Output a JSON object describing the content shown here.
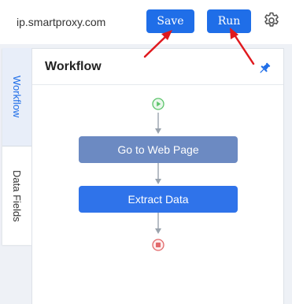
{
  "topbar": {
    "url": "ip.smartproxy.com",
    "save_label": "Save",
    "run_label": "Run",
    "settings_icon": "gear-icon"
  },
  "tabs": [
    {
      "label": "Workflow",
      "active": true
    },
    {
      "label": "Data Fields",
      "active": false
    }
  ],
  "panel": {
    "title": "Workflow",
    "pin_icon": "pin-icon"
  },
  "workflow": {
    "steps": [
      {
        "label": "Go to Web Page"
      },
      {
        "label": "Extract Data"
      }
    ]
  },
  "colors": {
    "primary": "#1f6ee8",
    "step_goto": "#6c8ac2",
    "step_extract": "#2f73ea",
    "start_node": "#5cc46a",
    "end_node": "#e2696b",
    "annotation_arrow": "#e0191e"
  }
}
